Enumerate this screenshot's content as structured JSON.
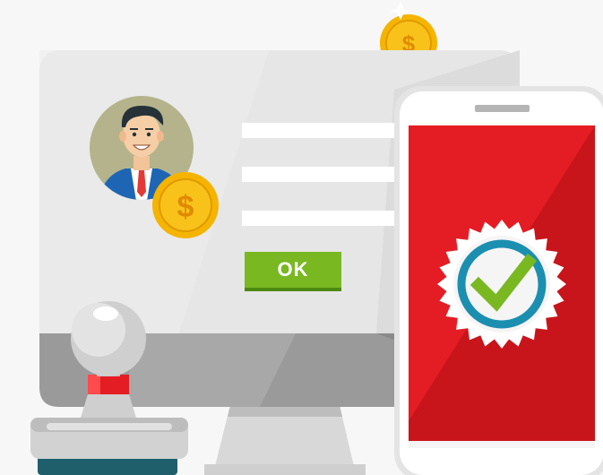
{
  "dialog": {
    "ok_label": "OK"
  },
  "colors": {
    "background": "#f7f7f7",
    "monitor": "#e6e6e6",
    "ok_button": "#79b821",
    "phone_screen": "#e41c23",
    "check_ring": "#1b8fb0",
    "check_mark": "#79b821",
    "coin": "#f5b400"
  },
  "icons": {
    "user": "avatar-businessman",
    "coin": "dollar-coin-icon",
    "badge": "verified-check-badge-icon",
    "stamp": "rubber-stamp-icon"
  }
}
